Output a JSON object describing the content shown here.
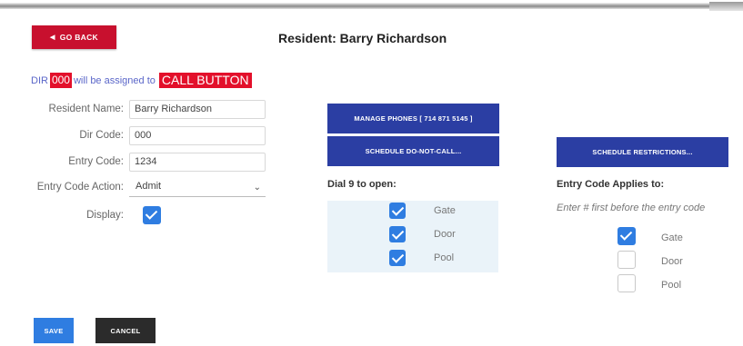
{
  "header": {
    "back_label": "GO BACK",
    "back_icon": "chevron-left-icon",
    "title": "Resident: Barry Richardson"
  },
  "assignment": {
    "prefix": "DIR",
    "dir_code": "000",
    "middle": "will be assigned to",
    "target": "CALL BUTTON"
  },
  "form": {
    "resident_name_label": "Resident Name:",
    "resident_name_value": "Barry Richardson",
    "dir_code_label": "Dir Code:",
    "dir_code_value": "000",
    "entry_code_label": "Entry Code:",
    "entry_code_value": "1234",
    "entry_action_label": "Entry Code Action:",
    "entry_action_value": "Admit",
    "display_label": "Display:",
    "display_checked": true
  },
  "actions": {
    "manage_phones": "MANAGE PHONES [ 714 871 5145 ]",
    "schedule_dnc": "SCHEDULE DO-NOT-CALL...",
    "schedule_restrictions": "SCHEDULE RESTRICTIONS..."
  },
  "dial": {
    "title": "Dial 9 to open:",
    "options": [
      {
        "label": "Gate",
        "checked": true
      },
      {
        "label": "Door",
        "checked": true
      },
      {
        "label": "Pool",
        "checked": true
      }
    ]
  },
  "entry_applies": {
    "title": "Entry Code Applies to:",
    "hint": "Enter # first before the entry code",
    "options": [
      {
        "label": "Gate",
        "checked": true
      },
      {
        "label": "Door",
        "checked": false
      },
      {
        "label": "Pool",
        "checked": false
      }
    ]
  },
  "footer": {
    "save_label": "SAVE",
    "cancel_label": "CANCEL"
  },
  "colors": {
    "accent_red": "#c8102e",
    "highlight_red": "#e3102b",
    "navy_button": "#2b3ea3",
    "checkbox_blue": "#2f7de1",
    "panel_bg": "#eaf3f9"
  }
}
